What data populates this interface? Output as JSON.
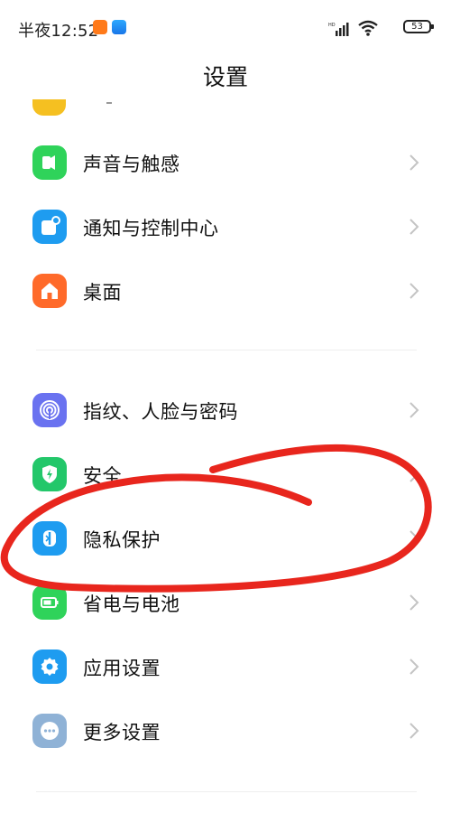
{
  "status_bar": {
    "time": "半夜12:52",
    "battery": "53",
    "hd_label": "HD"
  },
  "header": {
    "title": "设置"
  },
  "settings": {
    "group1": [
      {
        "label": "声音与触感",
        "icon": "speaker-icon",
        "color": "#2fd35a"
      },
      {
        "label": "通知与控制中心",
        "icon": "notification-icon",
        "color": "#1e9cf0"
      },
      {
        "label": "桌面",
        "icon": "home-icon",
        "color": "#ff6a2a"
      }
    ],
    "group2": [
      {
        "label": "指纹、人脸与密码",
        "icon": "fingerprint-icon",
        "color": "#6a72f0"
      },
      {
        "label": "安全",
        "icon": "shield-icon",
        "color": "#23c76a"
      },
      {
        "label": "隐私保护",
        "icon": "privacy-icon",
        "color": "#1e9cf0"
      },
      {
        "label": "省电与电池",
        "icon": "battery-icon",
        "color": "#2fd35a"
      },
      {
        "label": "应用设置",
        "icon": "gear-icon",
        "color": "#1e9cf0"
      },
      {
        "label": "更多设置",
        "icon": "more-icon",
        "color": "#8fb2d6"
      }
    ]
  },
  "colors": {
    "annotation": "#e8261d",
    "chevron": "#c4c4c4"
  }
}
